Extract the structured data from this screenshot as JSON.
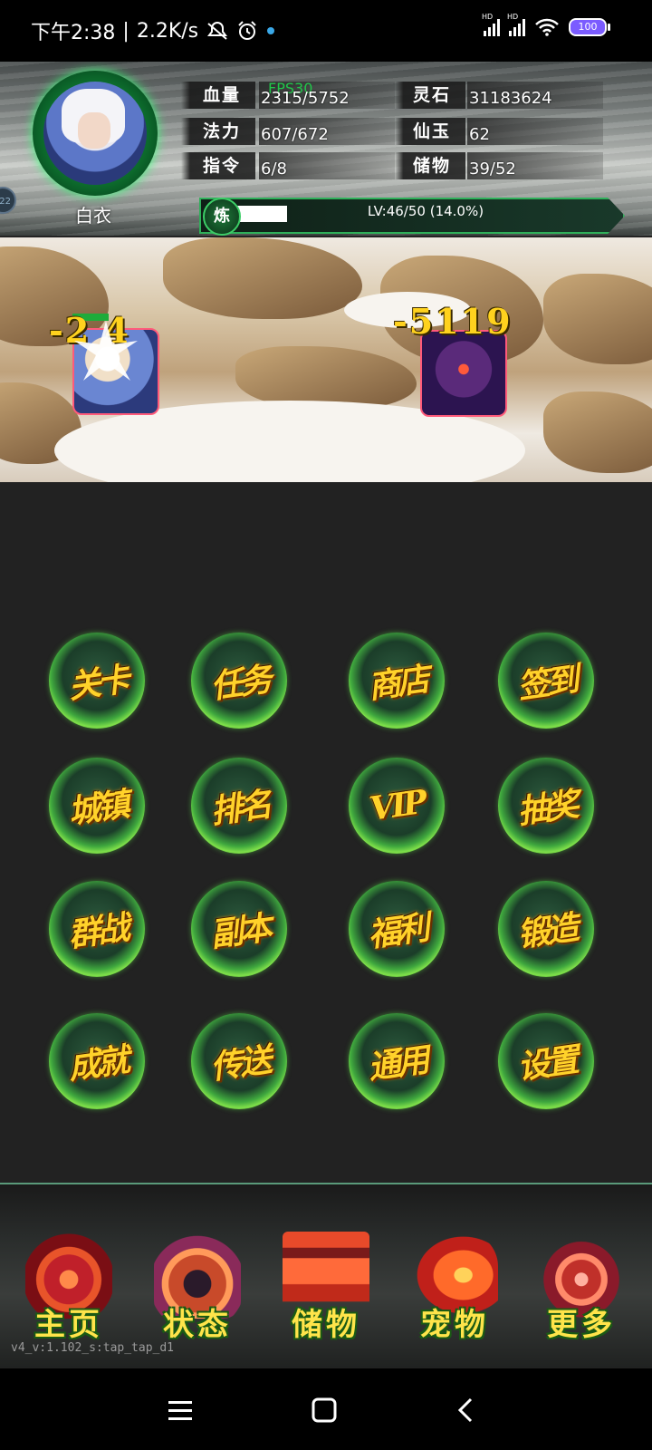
{
  "status_bar": {
    "time": "下午2:38",
    "separator": "|",
    "net_speed": "2.2K/s",
    "battery": "100",
    "signal_labels": [
      "HD",
      "HD"
    ],
    "icons": [
      "mute-icon",
      "alarm-icon",
      "app-dot-icon",
      "signal-icon",
      "signal-icon",
      "wifi-icon",
      "battery-icon"
    ]
  },
  "player": {
    "name": "白衣",
    "side_badge": "22",
    "fps": "FPS30",
    "stats": {
      "hp_label": "血量",
      "hp_value": "2315/5752",
      "mp_label": "法力",
      "mp_value": "607/672",
      "cmd_label": "指令",
      "cmd_value": "6/8",
      "spirit_label": "灵石",
      "spirit_value": "31183624",
      "jade_label": "仙玉",
      "jade_value": "62",
      "storage_label": "储物",
      "storage_value": "39/52"
    },
    "cultivation": {
      "badge": "炼",
      "text": "LV:46/50 (14.0%)",
      "progress": 0.14
    }
  },
  "battle": {
    "hero_damage": "-2 4",
    "enemy_damage": "-5119"
  },
  "menu": {
    "items": [
      {
        "label": "关卡",
        "icon": "stage-icon"
      },
      {
        "label": "任务",
        "icon": "task-icon"
      },
      {
        "label": "商店",
        "icon": "shop-icon"
      },
      {
        "label": "签到",
        "icon": "checkin-icon"
      },
      {
        "label": "城镇",
        "icon": "town-icon"
      },
      {
        "label": "排名",
        "icon": "ranking-icon"
      },
      {
        "label": "VIP",
        "icon": "vip-icon"
      },
      {
        "label": "抽奖",
        "icon": "lottery-icon"
      },
      {
        "label": "群战",
        "icon": "group-battle-icon"
      },
      {
        "label": "副本",
        "icon": "dungeon-icon"
      },
      {
        "label": "福利",
        "icon": "welfare-icon"
      },
      {
        "label": "锻造",
        "icon": "forge-icon"
      },
      {
        "label": "成就",
        "icon": "achievement-icon"
      },
      {
        "label": "传送",
        "icon": "teleport-icon"
      },
      {
        "label": "通用",
        "icon": "general-icon"
      },
      {
        "label": "设置",
        "icon": "settings-icon"
      }
    ]
  },
  "bottom_nav": {
    "items": [
      {
        "label": "主页",
        "icon": "home-icon"
      },
      {
        "label": "状态",
        "icon": "status-icon"
      },
      {
        "label": "储物",
        "icon": "storage-icon"
      },
      {
        "label": "宠物",
        "icon": "pet-icon"
      },
      {
        "label": "更多",
        "icon": "more-icon"
      }
    ]
  },
  "version": "v4_v:1.102_s:tap_tap_d1",
  "system_nav": [
    "menu-icon",
    "home-icon",
    "back-icon"
  ],
  "colors": {
    "accent_green": "#3ccd66",
    "menu_gold": "#ffd22a",
    "damage_yellow": "#ffd21e",
    "fps_green": "#21c64a"
  }
}
